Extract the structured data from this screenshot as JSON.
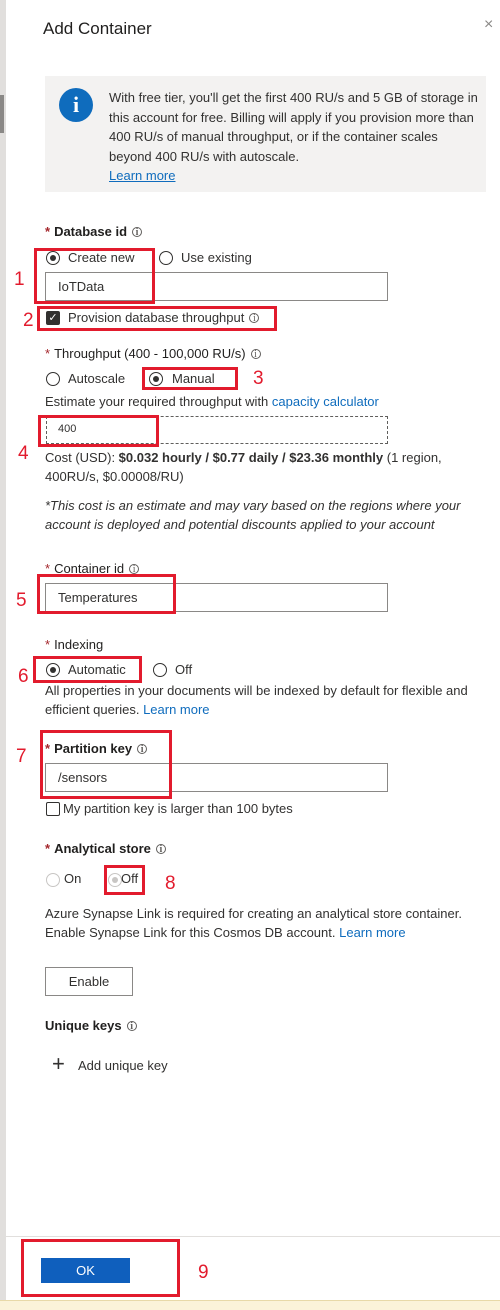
{
  "panel": {
    "title": "Add Container",
    "close_icon": "×"
  },
  "info": {
    "text": "With free tier, you'll get the first 400 RU/s and 5 GB of storage in this account for free. Billing will apply if you provision more than 400 RU/s of manual throughput, or if the container scales beyond 400 RU/s with autoscale.",
    "link": "Learn more",
    "icon_glyph": "i"
  },
  "database": {
    "label": "Database id",
    "create_new": "Create new",
    "use_existing": "Use existing",
    "value": "IoTData",
    "provision_label": "Provision database throughput"
  },
  "throughput": {
    "label": "Throughput (400 - 100,000 RU/s)",
    "autoscale": "Autoscale",
    "manual": "Manual",
    "estimate_text": "Estimate your required throughput with",
    "calculator_link": "capacity calculator",
    "value": "400",
    "cost_prefix": "Cost (USD): ",
    "cost_bold": "$0.032 hourly / $0.77 daily / $23.36 monthly",
    "cost_suffix": " (1 region, 400RU/s, $0.00008/RU)",
    "disclaimer": "*This cost is an estimate and may vary based on the regions where your account is deployed and potential discounts applied to your account"
  },
  "container": {
    "label": "Container id",
    "value": "Temperatures"
  },
  "indexing": {
    "label": "Indexing",
    "automatic": "Automatic",
    "off": "Off",
    "description": "All properties in your documents will be indexed by default for flexible and efficient queries.",
    "learn_more": "Learn more"
  },
  "partition": {
    "label": "Partition key",
    "value": "/sensors",
    "large_key_label": "My partition key is larger than 100 bytes"
  },
  "analytical": {
    "label": "Analytical store",
    "on": "On",
    "off": "Off",
    "description": "Azure Synapse Link is required for creating an analytical store container. Enable Synapse Link for this Cosmos DB account.",
    "learn_more": "Learn more",
    "enable_button": "Enable"
  },
  "unique_keys": {
    "label": "Unique keys",
    "add_label": "Add unique key",
    "add_icon": "+"
  },
  "footer": {
    "ok_label": "OK"
  },
  "annotations": {
    "n1": "1",
    "n2": "2",
    "n3": "3",
    "n4": "4",
    "n5": "5",
    "n6": "6",
    "n7": "7",
    "n8": "8",
    "n9": "9"
  },
  "colors": {
    "accent": "#0f6cbd",
    "annotation_red": "#e21b2d",
    "required": "#a4262c"
  }
}
